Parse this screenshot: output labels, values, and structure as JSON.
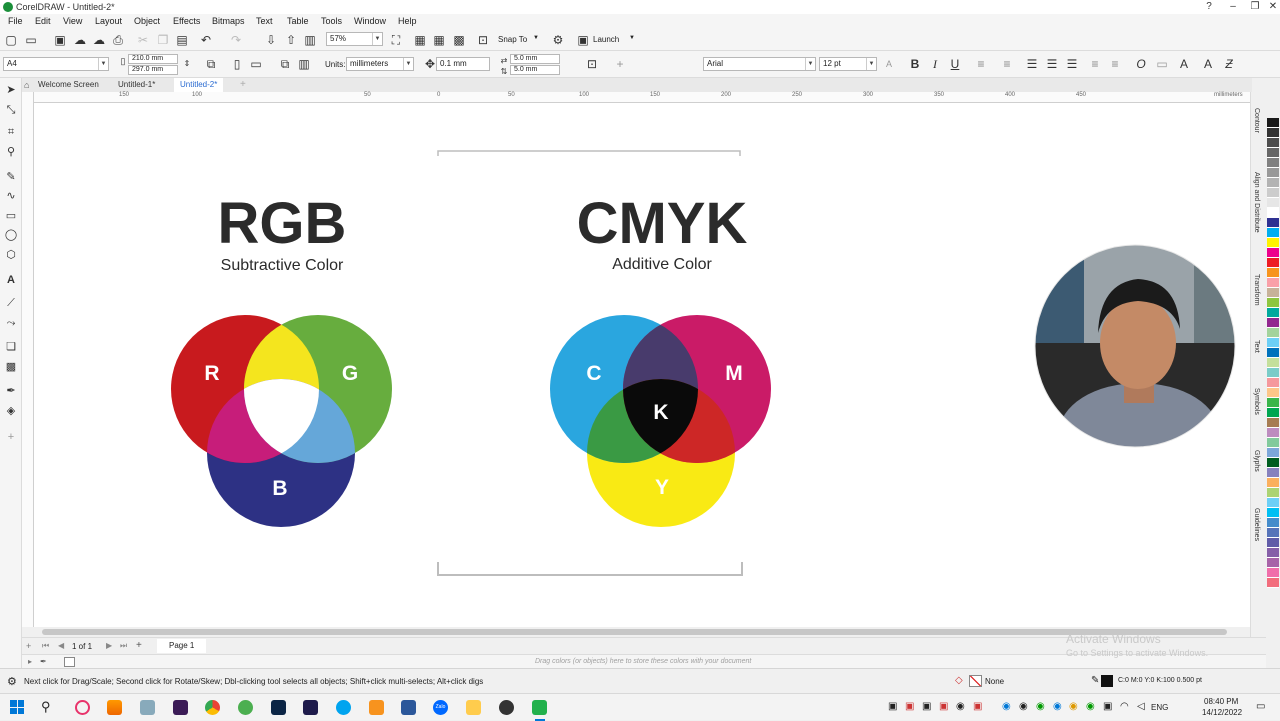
{
  "window": {
    "title": "CorelDRAW - Untitled-2*",
    "controls": [
      "?",
      "–",
      "❐",
      "✕"
    ]
  },
  "menu": [
    "File",
    "Edit",
    "View",
    "Layout",
    "Object",
    "Effects",
    "Bitmaps",
    "Text",
    "Table",
    "Tools",
    "Window",
    "Help"
  ],
  "toolbar": {
    "zoom": "57%",
    "snap_to": "Snap To",
    "launch": "Launch"
  },
  "property_bar": {
    "page_size": "A4",
    "width": "210.0 mm",
    "height": "297.0 mm",
    "units_label": "Units:",
    "units": "millimeters",
    "nudge": "0.1 mm",
    "dup_x": "5.0 mm",
    "dup_y": "5.0 mm",
    "font": "Arial",
    "font_size": "12 pt"
  },
  "doc_tabs": [
    "Welcome Screen",
    "Untitled-1*",
    "Untitled-2*"
  ],
  "ruler": {
    "ticks": [
      "150",
      "100",
      "50",
      "0",
      "50",
      "100",
      "150",
      "200",
      "250",
      "300",
      "350",
      "400",
      "450"
    ],
    "unit": "millimeters"
  },
  "artwork": {
    "rgb": {
      "title": "RGB",
      "subtitle": "Subtractive Color",
      "labels": [
        "R",
        "G",
        "B"
      ]
    },
    "cmyk": {
      "title": "CMYK",
      "subtitle": "Additive Color",
      "labels": [
        "C",
        "M",
        "Y",
        "K"
      ]
    }
  },
  "dockers": [
    "Contour",
    "Align and Distribute",
    "Transform",
    "Text",
    "Symbols",
    "Glyphs",
    "Guidelines"
  ],
  "palette": [
    "#1a1a1a",
    "#333333",
    "#4d4d4d",
    "#666666",
    "#808080",
    "#999999",
    "#b3b3b3",
    "#cccccc",
    "#e6e6e6",
    "#ffffff",
    "#2e3192",
    "#00aeef",
    "#fff200",
    "#ec008c",
    "#ed1c24",
    "#f7941d",
    "#f9a0a8",
    "#c7b299",
    "#8dc63f",
    "#00a99d",
    "#92278f",
    "#a3d39c",
    "#6dcff6",
    "#0072bc",
    "#c4df9b",
    "#7accc8",
    "#f5989d",
    "#fdc689",
    "#39b54a",
    "#00a651",
    "#a67c52",
    "#bd8cbf",
    "#82ca9c",
    "#7da7d9",
    "#005e20",
    "#8781bd",
    "#fbaf5d",
    "#acd373",
    "#6dcff6",
    "#00bff3",
    "#448ccb",
    "#5674b9",
    "#605ca8",
    "#855fa8",
    "#a763a8",
    "#f06eaa",
    "#f26d7d"
  ],
  "pages": {
    "counter": "1 of 1",
    "tab": "Page 1"
  },
  "color_hint": "Drag colors (or objects) here to store these colors with your document",
  "status": {
    "hint": "Next click for Drag/Scale; Second click for Rotate/Skew; Dbl-clicking tool selects all objects; Shift+click multi-selects; Alt+click digs",
    "fill": "None",
    "outline": "C:0 M:0 Y:0 K:100  0.500 pt"
  },
  "watermark": {
    "line1": "Activate Windows",
    "line2": "Go to Settings to activate Windows."
  },
  "taskbar": {
    "lang": "ENG",
    "time": "08:40 PM",
    "date": "14/12/2022",
    "zalo": "Zalo"
  }
}
